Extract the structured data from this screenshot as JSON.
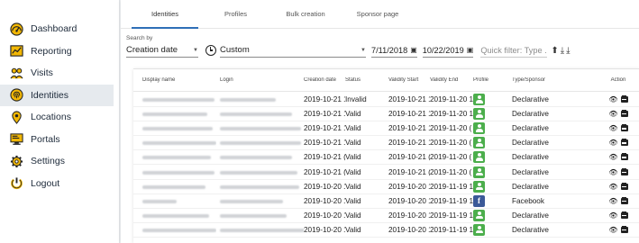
{
  "sidebar": {
    "items": [
      {
        "label": "Dashboard",
        "icon": "gauge-icon"
      },
      {
        "label": "Reporting",
        "icon": "chart-icon"
      },
      {
        "label": "Visits",
        "icon": "users-icon"
      },
      {
        "label": "Identities",
        "icon": "fingerprint-icon",
        "active": true
      },
      {
        "label": "Locations",
        "icon": "location-pin-icon"
      },
      {
        "label": "Portals",
        "icon": "monitor-icon"
      },
      {
        "label": "Settings",
        "icon": "gear-icon"
      },
      {
        "label": "Logout",
        "icon": "power-icon"
      }
    ]
  },
  "tabs": [
    "Identities",
    "Profiles",
    "Bulk creation",
    "Sponsor page"
  ],
  "filters": {
    "search_by_label": "Search by",
    "field_value": "Creation date",
    "range_value": "Custom",
    "date_from": "7/11/2018",
    "date_to": "10/22/2019",
    "quick_filter_placeholder": "Quick filter: Type ..."
  },
  "table": {
    "columns": [
      "Display name",
      "Login",
      "Creation date",
      "Status",
      "Validity Start",
      "Validity End",
      "Profile",
      "Type/Sponsor",
      "Action"
    ],
    "rows": [
      {
        "created": "2019-10-21 1",
        "status": "Invalid",
        "vstart": "2019-10-21 1",
        "vend": "2019-11-20 1",
        "profile": "declarative",
        "type": "Declarative"
      },
      {
        "created": "2019-10-21 1",
        "status": "Valid",
        "vstart": "2019-10-21 1",
        "vend": "2019-11-20 1",
        "profile": "declarative",
        "type": "Declarative"
      },
      {
        "created": "2019-10-21 1",
        "status": "Valid",
        "vstart": "2019-10-21 1",
        "vend": "2019-11-20 (",
        "profile": "declarative",
        "type": "Declarative"
      },
      {
        "created": "2019-10-21 1",
        "status": "Valid",
        "vstart": "2019-10-21 1",
        "vend": "2019-11-20 (",
        "profile": "declarative",
        "type": "Declarative"
      },
      {
        "created": "2019-10-21 (",
        "status": "Valid",
        "vstart": "2019-10-21 (",
        "vend": "2019-11-20 (",
        "profile": "declarative",
        "type": "Declarative"
      },
      {
        "created": "2019-10-21 (",
        "status": "Valid",
        "vstart": "2019-10-21 (",
        "vend": "2019-11-20 (",
        "profile": "declarative",
        "type": "Declarative"
      },
      {
        "created": "2019-10-20 1",
        "status": "Valid",
        "vstart": "2019-10-20 1",
        "vend": "2019-11-19 1",
        "profile": "declarative",
        "type": "Declarative"
      },
      {
        "created": "2019-10-20 1",
        "status": "Valid",
        "vstart": "2019-10-20 1",
        "vend": "2019-11-19 1",
        "profile": "facebook",
        "type": "Facebook"
      },
      {
        "created": "2019-10-20 1",
        "status": "Valid",
        "vstart": "2019-10-20 1",
        "vend": "2019-11-19 1",
        "profile": "declarative",
        "type": "Declarative"
      },
      {
        "created": "2019-10-20 1",
        "status": "Valid",
        "vstart": "2019-10-20 1",
        "vend": "2019-11-19 1",
        "profile": "declarative",
        "type": "Declarative"
      }
    ]
  },
  "colors": {
    "accent": "#2f6fb7",
    "declarative_badge": "#4cae4c",
    "facebook_badge": "#3b5998",
    "active_nav_bg": "#e6eaee"
  }
}
